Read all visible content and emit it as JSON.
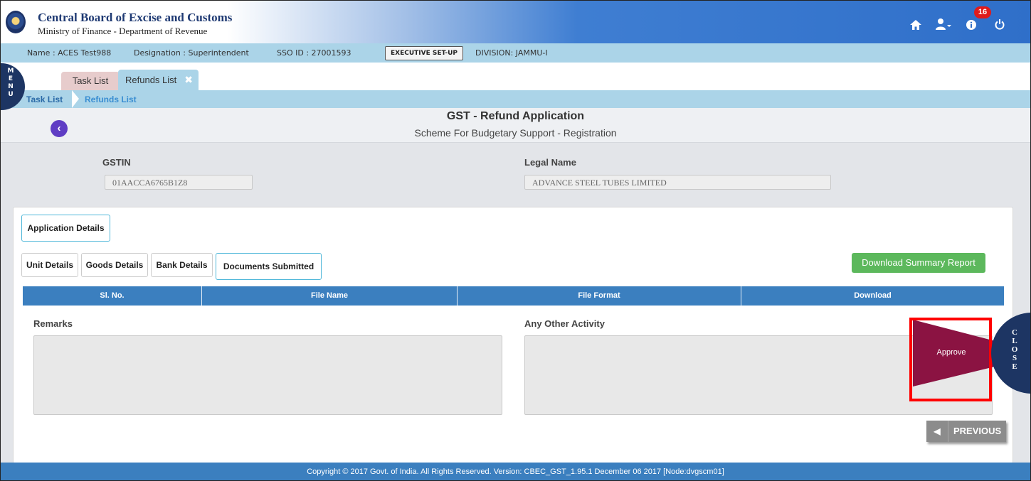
{
  "header": {
    "org_title": "Central Board of Excise and Customs",
    "org_subtitle": "Ministry of Finance - Department of Revenue",
    "notification_count": "16",
    "icons": [
      "home-icon",
      "user-icon",
      "info-icon",
      "power-icon"
    ]
  },
  "userbar": {
    "name": "Name : ACES Test988",
    "designation": "Designation : Superintendent",
    "sso": "SSO ID : 27001593",
    "exec_button": "EXECUTIVE SET-UP",
    "division": "DIVISION: JAMMU-I"
  },
  "menu_label": [
    "M",
    "E",
    "N",
    "U"
  ],
  "tabs": [
    {
      "label": "Task List"
    },
    {
      "label": "Refunds List"
    }
  ],
  "breadcrumb": [
    "Task List",
    "Refunds List"
  ],
  "page": {
    "title": "GST - Refund Application",
    "subtitle": "Scheme For Budgetary Support - Registration"
  },
  "fields": {
    "gstin_label": "GSTIN",
    "gstin_value": "01AACCA6765B1Z8",
    "legal_name_label": "Legal Name",
    "legal_name_value": "ADVANCE STEEL TUBES LIMITED"
  },
  "panel": {
    "application_details": "Application Details",
    "sub_tabs": [
      "Unit Details",
      "Goods Details",
      "Bank Details",
      "Documents Submitted"
    ],
    "download_button": "Download Summary Report",
    "table_headers": [
      "Sl. No.",
      "File Name",
      "File Format",
      "Download"
    ],
    "remarks_label": "Remarks",
    "other_activity_label": "Any Other Activity",
    "approve_button": "Approve",
    "close_label": [
      "C",
      "L",
      "O",
      "S",
      "E"
    ],
    "previous_button": "PREVIOUS"
  },
  "footer": {
    "text": "Copyright © 2017 Govt. of India. All Rights Reserved. Version: CBEC_GST_1.95.1 December 06 2017     [Node:dvgscm01]"
  },
  "colors": {
    "header_blue": "#2f6fc9",
    "info_bar": "#abd4e8",
    "table_header": "#3b7fbf",
    "approve": "#8b1342",
    "download_green": "#5cb85c",
    "badge_red": "#e01b1b"
  }
}
